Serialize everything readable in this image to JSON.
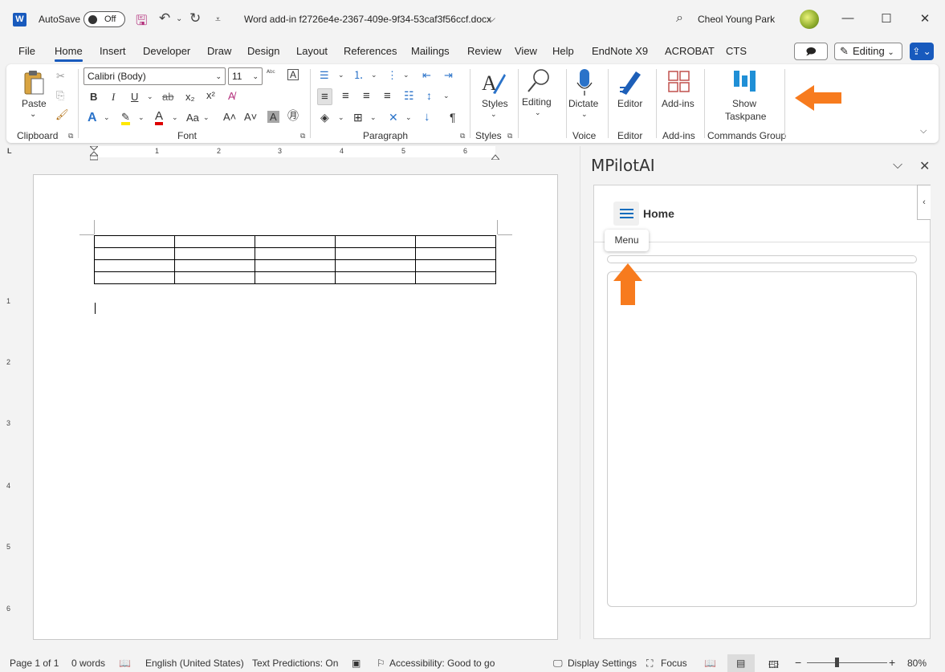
{
  "titlebar": {
    "app_letter": "W",
    "autosave_label": "AutoSave",
    "autosave_state": "Off",
    "document_title": "Word add-in f2726e4e-2367-409e-9f34-53caf3f56ccf.docx",
    "title_chevron": "⌵",
    "user_name": "Cheol Young Park",
    "search_glyph": "⌕",
    "minimize_glyph": "—",
    "maximize_glyph": "☐",
    "close_glyph": "✕",
    "save_glyph": "🖫",
    "undo_glyph": "↶",
    "redo_glyph": "↻",
    "customize_glyph": "⩡"
  },
  "menu": {
    "tabs": [
      "File",
      "Home",
      "Insert",
      "Developer",
      "Draw",
      "Design",
      "Layout",
      "References",
      "Mailings",
      "Review",
      "View",
      "Help",
      "EndNote X9",
      "ACROBAT",
      "CTS"
    ],
    "active": "Home",
    "comment_glyph": "🗩",
    "editing_label": "Editing",
    "editing_chevron": "⌄",
    "pen_glyph": "✎",
    "share_glyph": "⇪ ⌄"
  },
  "ribbon": {
    "groups": {
      "clipboard": "Clipboard",
      "font": "Font",
      "paragraph": "Paragraph",
      "styles": "Styles",
      "voice": "Voice",
      "editor": "Editor",
      "addins": "Add-ins",
      "commands": "Commands Group"
    },
    "paste_label": "Paste",
    "font_name": "Calibri (Body)",
    "font_size": "11",
    "styles_label": "Styles",
    "editing_label": "Editing",
    "dictate_label": "Dictate",
    "editor_label": "Editor",
    "addins_label": "Add-ins",
    "show_taskpane_line1": "Show",
    "show_taskpane_line2": "Taskpane",
    "launcher_glyph": "⧉",
    "chevron_small": "⌄",
    "expand_glyph": "⌵",
    "font_buttons": {
      "bold": "B",
      "italic": "I",
      "underline": "U",
      "strike": "ab",
      "subscript": "x₂",
      "superscript": "x²",
      "clear": "A̸",
      "text_effects": "A",
      "highlight": "✎",
      "font_color": "A",
      "change_case": "Aa",
      "grow": "A˄",
      "shrink": "A˅",
      "char_shading": "A",
      "enclose": "㊊",
      "phonetic": "ᴬᵇᶜ",
      "border": "A"
    },
    "para_buttons": {
      "bullets": "☰",
      "numbering": "⒈",
      "multilevel": "⋮",
      "decrease_indent": "⇤",
      "increase_indent": "⇥",
      "align_left": "≡",
      "center": "≡",
      "align_right": "≡",
      "justify": "≡",
      "distributed": "☷",
      "line_spacing": "↕",
      "shading": "◈",
      "borders": "⊞",
      "asian_layout": "✕",
      "sort": "↓",
      "show_marks": "¶"
    }
  },
  "ruler": {
    "numbers": [
      "1",
      "2",
      "3",
      "4",
      "5",
      "6"
    ],
    "vnumbers": [
      "1",
      "2",
      "3",
      "4",
      "5",
      "6"
    ],
    "corner": "L"
  },
  "document": {
    "table_rows": 4,
    "table_cols": 5
  },
  "taskpane": {
    "title": "MPilotAI",
    "collapse_glyph": "⌵",
    "close_glyph": "✕",
    "home_label": "Home",
    "menu_tooltip": "Menu",
    "side_collapse_glyph": "‹"
  },
  "status": {
    "page": "Page 1 of 1",
    "words": "0 words",
    "language": "English (United States)",
    "text_predictions": "Text Predictions: On",
    "accessibility": "Accessibility: Good to go",
    "display_settings": "Display Settings",
    "focus": "Focus",
    "zoom": "80%",
    "zoom_minus": "−",
    "zoom_plus": "+",
    "proof_glyph": "📖",
    "acc_glyph": "⚐",
    "display_glyph": "🖵",
    "focus_glyph": "⛶",
    "read_glyph": "📖",
    "print_glyph": "▤",
    "web_glyph": "🖽",
    "macro_glyph": "▣"
  },
  "colors": {
    "accent": "#185abd",
    "arrow": "#f77b1e",
    "hamburger": "#0f6cbd"
  }
}
